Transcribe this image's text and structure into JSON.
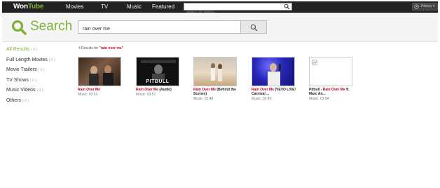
{
  "brand": {
    "part1": "Won",
    "part2": "Tube",
    "accent": "#7fb23a"
  },
  "nav": [
    {
      "label": "Movies"
    },
    {
      "label": "TV"
    },
    {
      "label": "Music"
    },
    {
      "label": "Featured"
    }
  ],
  "top_search": {
    "placeholder": "Search for videos..."
  },
  "history": {
    "label": "History",
    "icon": "clock-icon"
  },
  "search_logo": {
    "label": "Search",
    "icon": "search-icon"
  },
  "main_search": {
    "value": "rain over me",
    "button_icon": "search-icon"
  },
  "sidebar": [
    {
      "label": "All Results",
      "count": "( 4 )",
      "active": true
    },
    {
      "label": "Full Length Movies",
      "count": "( 0 )"
    },
    {
      "label": "Movie Trailers",
      "count": "( 0 )"
    },
    {
      "label": "TV Shows",
      "count": "( 0 )"
    },
    {
      "label": "Music Videos",
      "count": "( 4 )"
    },
    {
      "label": "Others",
      "count": "( 0 )"
    }
  ],
  "results": {
    "prefix": "4 Results for",
    "query": "\"rain over me\"",
    "items": [
      {
        "title_hl": "Rain Over Me",
        "title_rest": "",
        "title_line2": "",
        "meta": "Music: 03:53"
      },
      {
        "title_hl": "Rain Over Me",
        "title_rest": " (Audio)",
        "title_line2": "",
        "meta": "Music: 03:51",
        "thumb_text": "PITBULL"
      },
      {
        "title_hl": "Rain Over Me",
        "title_rest": " (Behind the",
        "title_line2": "Scenes)",
        "meta": "Music: 01:48"
      },
      {
        "title_hl": "Rain Over Me",
        "title_rest": " (VEVO LIVE!",
        "title_line2": "Carnival ...",
        "meta": "Music: 02:40"
      },
      {
        "title_pre": "Pitbull - ",
        "title_hl": "Rain Over Me",
        "title_rest": " ft.",
        "title_line2": "Marc An...",
        "meta": "Music: 03:54"
      }
    ]
  }
}
